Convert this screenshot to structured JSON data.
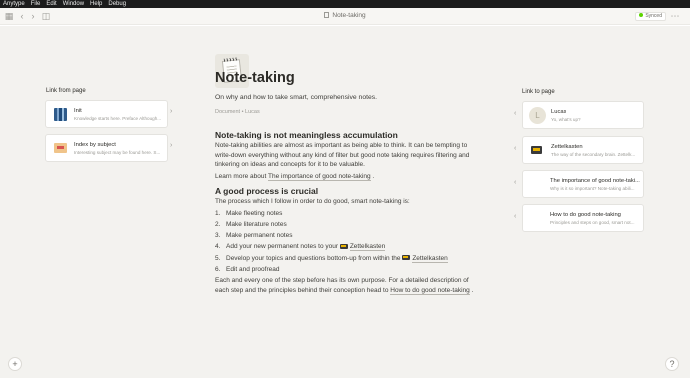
{
  "menubar": {
    "items": [
      "Anytype",
      "File",
      "Edit",
      "Window",
      "Help",
      "Debug"
    ]
  },
  "header": {
    "title": "Note-taking",
    "sync_status": "Synced"
  },
  "page": {
    "title": "Note-taking",
    "subtitle": "On why and how to take smart, comprehensive notes.",
    "meta": "Document  •  Lucas",
    "section1": {
      "heading": "Note-taking is not meaningless accumulation",
      "paragraph": "Note-taking abilities are almost as important as being able to think. It can be tempting to write-down everything without any kind of filter but good note taking requires filtering and tinkering on ideas and concepts for it to be valuable.",
      "learn_prefix": "Learn more about ",
      "learn_link": "The importance of good note-taking",
      "learn_suffix": " ."
    },
    "section2": {
      "heading": "A good process is crucial",
      "intro": "The process which I follow in order to do good, smart note-taking is:",
      "steps": [
        {
          "num": "1.",
          "text": "Make fleeting notes"
        },
        {
          "num": "2.",
          "text": "Make literature notes"
        },
        {
          "num": "3.",
          "text": "Make permanent notes"
        },
        {
          "num": "4.",
          "text": "Add your new permanent notes to your ",
          "link": "Zettelkasten"
        },
        {
          "num": "5.",
          "text": "Develop your topics and questions bottom-up from within the ",
          "link": "Zettelkasten"
        },
        {
          "num": "6.",
          "text": "Edit and proofread"
        }
      ],
      "closing_prefix": "Each and every one of the step before has its own purpose. For a detailed description of each step and the principles behind their conception head to ",
      "closing_link": "How to do good note-taking",
      "closing_suffix": " ."
    }
  },
  "left_panel": {
    "label": "Link from page",
    "cards": [
      {
        "title": "Init",
        "desc": "Knowledge starts here. Preface Although...",
        "icon": "init-image-icon"
      },
      {
        "title": "Index by subject",
        "desc": "Interesting subject may be found here. S...",
        "icon": "folder-icon"
      }
    ]
  },
  "right_panel": {
    "label": "Link to page",
    "cards": [
      {
        "title": "Lucas",
        "desc": "Yo, what's up?",
        "icon": "avatar-icon",
        "avatar_letter": "L"
      },
      {
        "title": "Zettelkasten",
        "desc": "The way of the secondary brain. Zettelk...",
        "icon": "zettelkasten-icon"
      },
      {
        "title": "The importance of good note-taki...",
        "desc": "Why is it so important? Note-taking abili...",
        "icon": ""
      },
      {
        "title": "How to do good note-taking",
        "desc": "Principles and steps on good, smart not...",
        "icon": ""
      }
    ]
  },
  "footer": {
    "add_label": "+",
    "help_label": "?"
  }
}
